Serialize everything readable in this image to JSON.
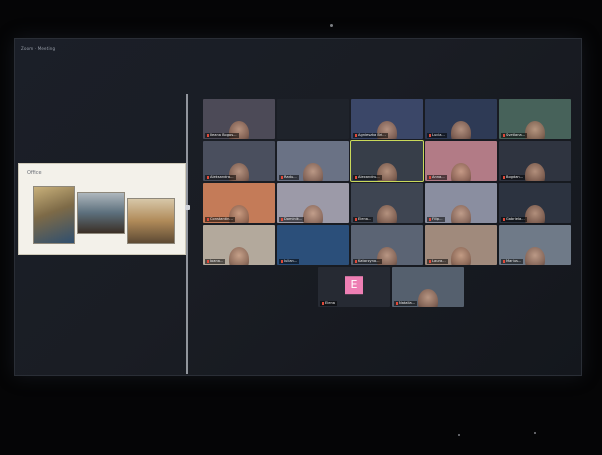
{
  "window": {
    "title": "Zoom · Meeting"
  },
  "share": {
    "title": "Office"
  },
  "colors": {
    "avatar_pink": "#ee7fb4",
    "active_speaker": "#c9d95a",
    "muted_mic": "#e04a3a"
  },
  "participants": [
    {
      "name": "Ileana Bogos...",
      "bg": "#4c4a57",
      "face": true
    },
    {
      "name": "",
      "bg": "#1f232b",
      "face": false
    },
    {
      "name": "Agnieszka Bri...",
      "bg": "#3b4768",
      "face": true
    },
    {
      "name": "Lucia...",
      "bg": "#2e3a55",
      "face": true
    },
    {
      "name": "Svetlana...",
      "bg": "#47625a",
      "face": true
    },
    {
      "name": "Aleksandra...",
      "bg": "#4a4f5e",
      "face": true
    },
    {
      "name": "Radu...",
      "bg": "#6a7285",
      "face": true
    },
    {
      "name": "Alexandru...",
      "bg": "#373e49",
      "face": true,
      "active": true
    },
    {
      "name": "Anna...",
      "bg": "#b27b86",
      "face": true
    },
    {
      "name": "Bogdan...",
      "bg": "#2f3440",
      "face": true
    },
    {
      "name": "Constantin...",
      "bg": "#c47b58",
      "face": true
    },
    {
      "name": "Dominik...",
      "bg": "#9c9aa8",
      "face": true
    },
    {
      "name": "Elena...",
      "bg": "#3e4552",
      "face": true
    },
    {
      "name": "Filip...",
      "bg": "#8a8ea0",
      "face": true
    },
    {
      "name": "Gabriela...",
      "bg": "#2c3340",
      "face": true
    },
    {
      "name": "Ioana...",
      "bg": "#b3a99c",
      "face": true
    },
    {
      "name": "Iulian...",
      "bg": "#2b4f7a",
      "face": false
    },
    {
      "name": "Katarzyna...",
      "bg": "#5b6474",
      "face": true
    },
    {
      "name": "Laura...",
      "bg": "#a08a7c",
      "face": true
    },
    {
      "name": "Marius...",
      "bg": "#6f7a88",
      "face": true
    },
    {
      "name": "Elena",
      "bg": "#262a33",
      "face": false,
      "avatar": "E"
    },
    {
      "name": "Natalia...",
      "bg": "#55606e",
      "face": true
    }
  ]
}
